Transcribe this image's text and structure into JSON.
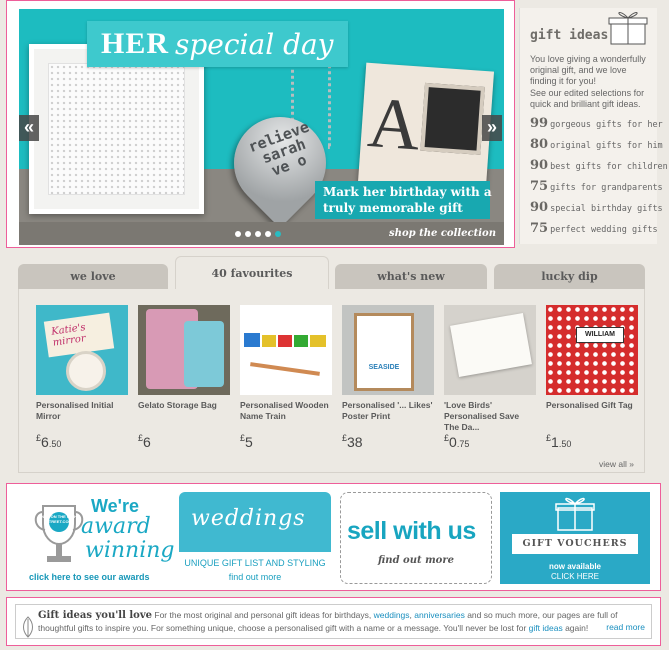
{
  "hero": {
    "headline_bold": "HER",
    "headline_script": "special day",
    "heart_text": [
      "relieve",
      "sarah",
      "ve o"
    ],
    "card_letter": "A",
    "caption_line1": "Mark her birthday with a",
    "caption_line2": "truly memorable gift",
    "prev_arrow": "«",
    "next_arrow": "»",
    "shop_link": "shop the collection",
    "slides_count": 5,
    "active_slide_index": 4
  },
  "gift_ideas": {
    "title": "gift ideas",
    "intro": "You love giving a wonderfully original gift, and we love finding it for you!",
    "intro2": "See our edited selections for quick and brilliant gift ideas.",
    "items": [
      {
        "num": "99",
        "label": "gorgeous gifts for her"
      },
      {
        "num": "80",
        "label": "original gifts for him"
      },
      {
        "num": "90",
        "label": "best gifts for children"
      },
      {
        "num": "75",
        "label": "gifts for grandparents"
      },
      {
        "num": "90",
        "label": "special birthday gifts"
      },
      {
        "num": "75",
        "label": "perfect wedding gifts"
      }
    ]
  },
  "tabs": [
    {
      "label": "we love"
    },
    {
      "label": "40 favourites"
    },
    {
      "label": "what's new"
    },
    {
      "label": "lucky dip"
    }
  ],
  "products": [
    {
      "name": "Personalised Initial Mirror",
      "currency": "£",
      "whole": "6",
      "frac": ".50",
      "img_text": "Katie's mirror"
    },
    {
      "name": "Gelato Storage Bag",
      "currency": "£",
      "whole": "6",
      "frac": ""
    },
    {
      "name": "Personalised Wooden Name Train",
      "currency": "£",
      "whole": "5",
      "frac": ""
    },
    {
      "name": "Personalised '... Likes' Poster Print",
      "currency": "£",
      "whole": "38",
      "frac": "",
      "img_text": "SEASIDE"
    },
    {
      "name": "'Love Birds' Personalised Save The Da...",
      "currency": "£",
      "whole": "0",
      "frac": ".75"
    },
    {
      "name": "Personalised Gift Tag",
      "currency": "£",
      "whole": "1",
      "frac": ".50",
      "img_text": "WILLIAM"
    }
  ],
  "view_all": "view all »",
  "banners": {
    "award_badge": "NOT ON THE HIGH STREET.COM",
    "award_t1": "We're",
    "award_t2": "award",
    "award_t3": "winning",
    "award_link": "click here to see our awards",
    "weddings_script": "weddings",
    "weddings_sub": "UNIQUE GIFT LIST AND STYLING",
    "weddings_link": "find out more",
    "sell_title": "sell with us",
    "sell_link": "find out more",
    "vouch_label": "GIFT VOUCHERS",
    "vouch_sub": "now available",
    "vouch_link": "CLICK HERE"
  },
  "footer": {
    "heading": "Gift ideas you'll love",
    "text1": " For the most original and personal gift ideas for birthdays, ",
    "link1": "weddings",
    "text2": ", ",
    "link2": "anniversaries",
    "text3": " and so much more, our pages are full of thoughtful gifts to inspire you. For something unique, choose a personalised gift with a name or a message. You'll never be lost for ",
    "link3": "gift ideas",
    "text4": " again!",
    "read_more": "read more"
  },
  "colors": {
    "teal": "#1dbcc0",
    "highlight_border": "#ee5e9a",
    "link_blue": "#1a8fbf"
  }
}
